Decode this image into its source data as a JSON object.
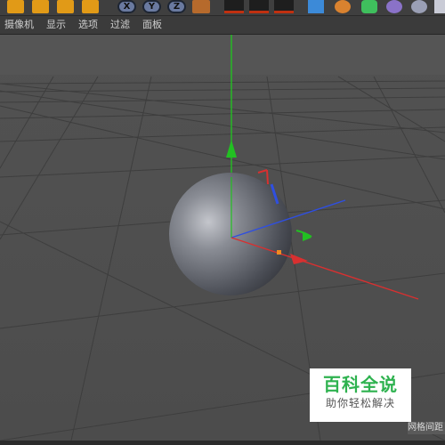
{
  "toolbar": {
    "icons": [
      "move-icon",
      "scale-icon",
      "rotate-icon",
      "add-icon",
      "x-axis-lock",
      "y-axis-lock",
      "z-axis-lock",
      "coordinate-system-icon",
      "render-view-icon",
      "render-picture-icon",
      "render-settings-icon",
      "cube-icon",
      "pen-icon",
      "gear-object-icon",
      "effector-icon",
      "light-icon"
    ],
    "x_label": "X",
    "y_label": "Y",
    "z_label": "Z",
    "accent": "#e19a17"
  },
  "menubar": {
    "items": [
      "摄像机",
      "显示",
      "选项",
      "过滤",
      "面板"
    ]
  },
  "viewport": {
    "object": "sphere",
    "axis_colors": {
      "x": "#d83030",
      "y": "#22c022",
      "z": "#2f4fe0"
    }
  },
  "watermark": {
    "main": "百科全说",
    "sub": "助你轻松解决",
    "color": "#2eb24f"
  },
  "status": {
    "grid_label": "网格间距"
  }
}
